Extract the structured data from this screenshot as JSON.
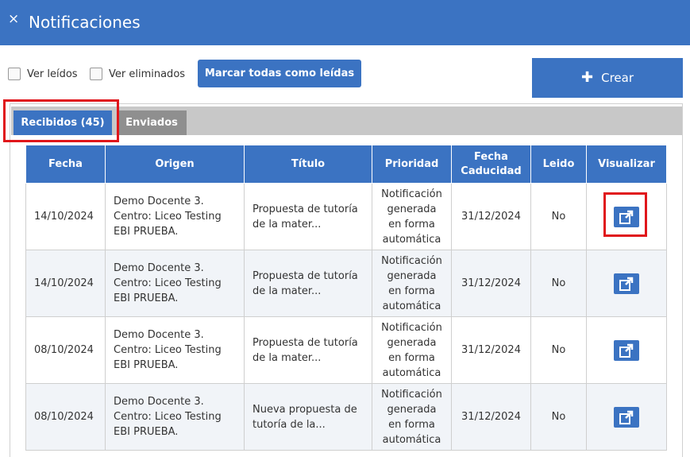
{
  "window": {
    "title": "Notificaciones",
    "close_glyph": "×"
  },
  "filters": {
    "ver_leidos": "Ver leídos",
    "ver_eliminados": "Ver eliminados"
  },
  "actions": {
    "mark_all": "Marcar todas como leídas",
    "create": "Crear"
  },
  "tabs": {
    "recibidos": "Recibidos (45)",
    "enviados": "Enviados"
  },
  "table": {
    "headers": {
      "fecha": "Fecha",
      "origen": "Origen",
      "titulo": "Título",
      "prioridad": "Prioridad",
      "caducidad_1": "Fecha",
      "caducidad_2": "Caducidad",
      "leido": "Leido",
      "visualizar": "Visualizar"
    },
    "rows": [
      {
        "fecha": "14/10/2024",
        "origen": [
          "Demo Docente 3.",
          "Centro: Liceo Testing",
          "EBI PRUEBA."
        ],
        "titulo": [
          "Propuesta de tutoría",
          "de la mater..."
        ],
        "prioridad": [
          "Notificación",
          "generada",
          "en forma",
          "automática"
        ],
        "caducidad": "31/12/2024",
        "leido": "No"
      },
      {
        "fecha": "14/10/2024",
        "origen": [
          "Demo Docente 3.",
          "Centro: Liceo Testing",
          "EBI PRUEBA."
        ],
        "titulo": [
          "Propuesta de tutoría",
          "de la mater..."
        ],
        "prioridad": [
          "Notificación",
          "generada",
          "en forma",
          "automática"
        ],
        "caducidad": "31/12/2024",
        "leido": "No"
      },
      {
        "fecha": "08/10/2024",
        "origen": [
          "Demo Docente 3.",
          "Centro: Liceo Testing",
          "EBI PRUEBA."
        ],
        "titulo": [
          "Propuesta de tutoría",
          "de la mater..."
        ],
        "prioridad": [
          "Notificación",
          "generada",
          "en forma",
          "automática"
        ],
        "caducidad": "31/12/2024",
        "leido": "No"
      },
      {
        "fecha": "08/10/2024",
        "origen": [
          "Demo Docente 3.",
          "Centro: Liceo Testing",
          "EBI PRUEBA."
        ],
        "titulo": [
          "Nueva propuesta de",
          "tutoría de la..."
        ],
        "prioridad": [
          "Notificación",
          "generada",
          "en forma",
          "automática"
        ],
        "caducidad": "31/12/2024",
        "leido": "No"
      }
    ]
  },
  "icons": {
    "close": "close-icon",
    "plus": "plus-icon",
    "visualizar": "external-link-icon"
  },
  "colors": {
    "primary": "#3b73c2",
    "tab_inactive": "#8f8f8f",
    "highlight": "#e0161b"
  }
}
